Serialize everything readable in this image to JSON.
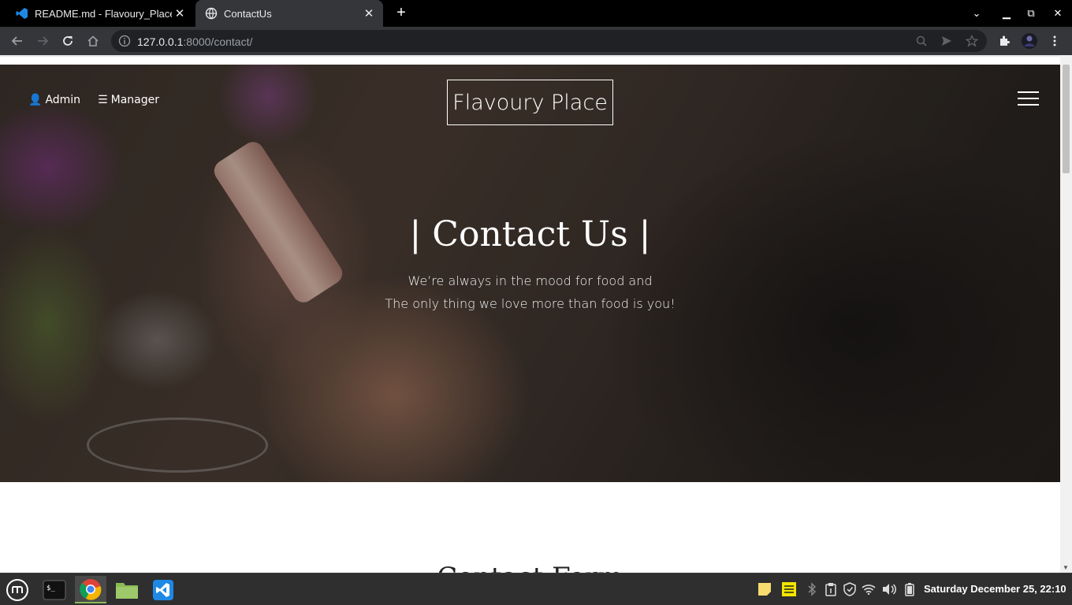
{
  "browser": {
    "tabs": [
      {
        "title": "README.md - Flavoury_Place",
        "active": false
      },
      {
        "title": "ContactUs",
        "active": true
      }
    ],
    "url_host": "127.0.0.1",
    "url_path": ":8000/contact/"
  },
  "page": {
    "nav_left": [
      {
        "icon": "user-icon",
        "label": "Admin"
      },
      {
        "icon": "list-icon",
        "label": "Manager"
      }
    ],
    "brand": "Flavoury Place",
    "hero_title": "| Contact Us |",
    "hero_line1": "We’re always in the mood for food and",
    "hero_line2": "The only thing we love more than food is you!",
    "section_heading": "Contact Form"
  },
  "taskbar": {
    "clock": "Saturday December 25, 22:10"
  },
  "colors": {
    "tab_strip": "#000000",
    "toolbar": "#35363a",
    "taskbar": "#2f2f2f",
    "accent_green": "#8ab956"
  }
}
